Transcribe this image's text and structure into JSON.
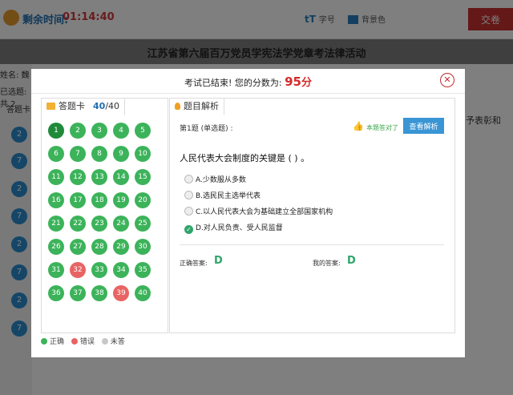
{
  "background": {
    "timer_label": "剩余时间:",
    "timer_value": "01:14:40",
    "font_tool": "字号",
    "bg_color_tool": "背景色",
    "submit": "交卷",
    "exam_title": "江苏省第六届百万党员学宪法学党章考法律活动",
    "side_name": "姓名: 魏",
    "side_selected": "已选题: 共 2",
    "side_card": "答题卡",
    "right_snippet": "予表彰和",
    "side_numbers": [
      "2",
      "7",
      "2",
      "7",
      "2",
      "7",
      "2",
      "7"
    ]
  },
  "modal": {
    "result_text": "考试已结束! 您的分数为:",
    "score": "95",
    "score_unit": "分",
    "close_icon": "close-icon"
  },
  "answer_card": {
    "title": "答题卡",
    "answered": "40",
    "total": "/40",
    "items": [
      {
        "n": "1",
        "status": "current"
      },
      {
        "n": "2",
        "status": "correct"
      },
      {
        "n": "3",
        "status": "correct"
      },
      {
        "n": "4",
        "status": "correct"
      },
      {
        "n": "5",
        "status": "correct"
      },
      {
        "n": "6",
        "status": "correct"
      },
      {
        "n": "7",
        "status": "correct"
      },
      {
        "n": "8",
        "status": "correct"
      },
      {
        "n": "9",
        "status": "correct"
      },
      {
        "n": "10",
        "status": "correct"
      },
      {
        "n": "11",
        "status": "correct"
      },
      {
        "n": "12",
        "status": "correct"
      },
      {
        "n": "13",
        "status": "correct"
      },
      {
        "n": "14",
        "status": "correct"
      },
      {
        "n": "15",
        "status": "correct"
      },
      {
        "n": "16",
        "status": "correct"
      },
      {
        "n": "17",
        "status": "correct"
      },
      {
        "n": "18",
        "status": "correct"
      },
      {
        "n": "19",
        "status": "correct"
      },
      {
        "n": "20",
        "status": "correct"
      },
      {
        "n": "21",
        "status": "correct"
      },
      {
        "n": "22",
        "status": "correct"
      },
      {
        "n": "23",
        "status": "correct"
      },
      {
        "n": "24",
        "status": "correct"
      },
      {
        "n": "25",
        "status": "correct"
      },
      {
        "n": "26",
        "status": "correct"
      },
      {
        "n": "27",
        "status": "correct"
      },
      {
        "n": "28",
        "status": "correct"
      },
      {
        "n": "29",
        "status": "correct"
      },
      {
        "n": "30",
        "status": "correct"
      },
      {
        "n": "31",
        "status": "correct"
      },
      {
        "n": "32",
        "status": "wrong"
      },
      {
        "n": "33",
        "status": "correct"
      },
      {
        "n": "34",
        "status": "correct"
      },
      {
        "n": "35",
        "status": "correct"
      },
      {
        "n": "36",
        "status": "correct"
      },
      {
        "n": "37",
        "status": "correct"
      },
      {
        "n": "38",
        "status": "correct"
      },
      {
        "n": "39",
        "status": "wrong"
      },
      {
        "n": "40",
        "status": "correct"
      }
    ],
    "legend": {
      "correct": "正确",
      "wrong": "错误",
      "unanswered": "未答"
    }
  },
  "colors": {
    "correct": "#3cb35a",
    "current": "#1f8a3a",
    "wrong": "#e86464",
    "unanswered": "#c8c8c8",
    "accent": "#3a95d4"
  },
  "analysis": {
    "title": "题目解析",
    "question_number": "第1题 (单选题) :",
    "correct_badge": "本题答对了",
    "view_button": "查看解析",
    "question": "人民代表大会制度的关键是 ( ) 。",
    "options": [
      {
        "label": "A.少数服从多数",
        "selected": false
      },
      {
        "label": "B.选民民主选举代表",
        "selected": false
      },
      {
        "label": "C.以人民代表大会为基础建立全部国家机构",
        "selected": false
      },
      {
        "label": "D.对人民负责、受人民监督",
        "selected": true
      }
    ],
    "correct_answer_label": "正确答案:",
    "correct_answer": "D",
    "my_answer_label": "我的答案:",
    "my_answer": "D"
  }
}
